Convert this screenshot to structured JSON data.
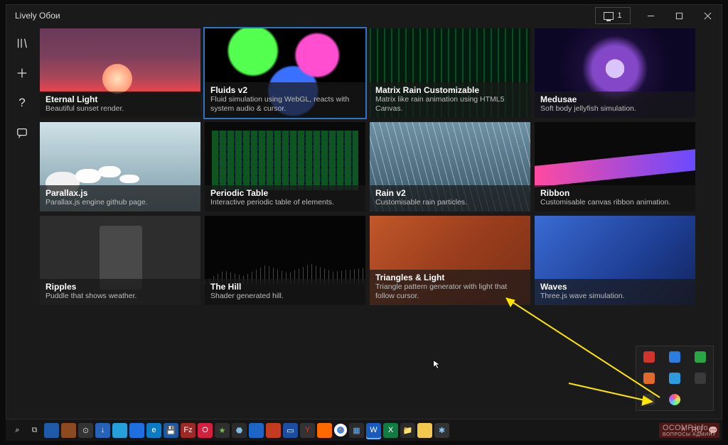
{
  "app": {
    "title": "Lively Обои"
  },
  "title_controls": {
    "screen_label": "1"
  },
  "nav": {
    "items": [
      {
        "name": "library-icon"
      },
      {
        "name": "add-icon"
      },
      {
        "name": "help-icon"
      },
      {
        "name": "feedback-icon"
      }
    ]
  },
  "gallery": [
    {
      "title": "Eternal Light",
      "desc": "Beautiful sunset render.",
      "thumb": "t-sunset",
      "selected": false
    },
    {
      "title": "Fluids v2",
      "desc": "Fluid simulation using WebGL, reacts with system audio & cursor.",
      "thumb": "t-fluids",
      "selected": true
    },
    {
      "title": "Matrix Rain Customizable",
      "desc": "Matrix like rain animation using HTML5 Canvas.",
      "thumb": "t-matrix",
      "selected": false
    },
    {
      "title": "Medusae",
      "desc": "Soft body jellyfish simulation.",
      "thumb": "t-medusa",
      "selected": false
    },
    {
      "title": "Parallax.js",
      "desc": "Parallax.js engine github page.",
      "thumb": "t-parallax",
      "selected": false
    },
    {
      "title": "Periodic Table",
      "desc": "Interactive periodic table of elements.",
      "thumb": "t-ptable",
      "selected": false
    },
    {
      "title": "Rain v2",
      "desc": "Customisable rain particles.",
      "thumb": "t-rain",
      "selected": false
    },
    {
      "title": "Ribbon",
      "desc": "Customisable canvas ribbon animation.",
      "thumb": "t-ribbon",
      "selected": false
    },
    {
      "title": "Ripples",
      "desc": "Puddle that shows weather.",
      "thumb": "t-ripples",
      "selected": false
    },
    {
      "title": "The Hill",
      "desc": "Shader generated hill.",
      "thumb": "t-hill",
      "selected": false
    },
    {
      "title": "Triangles & Light",
      "desc": "Triangle pattern generator with light that follow cursor.",
      "thumb": "t-triangles",
      "selected": false
    },
    {
      "title": "Waves",
      "desc": "Three.js wave simulation.",
      "thumb": "t-waves",
      "selected": false
    }
  ],
  "taskbar": {
    "left_icons": [
      {
        "name": "search-icon",
        "bg": "transparent",
        "glyph": "⌕",
        "color": "#fff"
      },
      {
        "name": "taskview-icon",
        "bg": "transparent",
        "glyph": "⧉",
        "color": "#ccc"
      },
      {
        "name": "app-1",
        "bg": "#1e5aa8",
        "glyph": "",
        "color": ""
      },
      {
        "name": "app-2",
        "bg": "#8b4a1f",
        "glyph": "",
        "color": ""
      },
      {
        "name": "app-3",
        "bg": "#333",
        "glyph": "⊙",
        "color": "#ccc"
      },
      {
        "name": "app-4",
        "bg": "#2762b9",
        "glyph": "↓",
        "color": "#fff"
      },
      {
        "name": "app-5",
        "bg": "#26a0da",
        "glyph": "",
        "color": ""
      },
      {
        "name": "app-6",
        "bg": "#1f6fe0",
        "glyph": "",
        "color": ""
      },
      {
        "name": "app-7",
        "bg": "#0a7bc4",
        "glyph": "e",
        "color": "#fff"
      },
      {
        "name": "app-8",
        "bg": "#1d58a0",
        "glyph": "💾",
        "color": ""
      },
      {
        "name": "app-9",
        "bg": "#9c2828",
        "glyph": "Fz",
        "color": "#fff"
      },
      {
        "name": "app-10",
        "bg": "#d3203f",
        "glyph": "O",
        "color": "#fff"
      },
      {
        "name": "app-11",
        "bg": "#2e2e2e",
        "glyph": "★",
        "color": "#7bbf4f"
      },
      {
        "name": "app-12",
        "bg": "#2b2b2b",
        "glyph": "⬣",
        "color": "#7fbce0"
      },
      {
        "name": "app-13",
        "bg": "#1d66c6",
        "glyph": "",
        "color": ""
      },
      {
        "name": "app-14",
        "bg": "#c23c1f",
        "glyph": "",
        "color": ""
      },
      {
        "name": "app-15",
        "bg": "#1b4ea0",
        "glyph": "▭",
        "color": "#fff"
      },
      {
        "name": "app-16",
        "bg": "#333",
        "glyph": "Y",
        "color": "#d33"
      },
      {
        "name": "app-17",
        "bg": "#ff6a00",
        "glyph": "",
        "color": ""
      },
      {
        "name": "app-18",
        "bg": "",
        "glyph": "",
        "color": "",
        "chrome": true
      },
      {
        "name": "app-19",
        "bg": "#2b2b2b",
        "glyph": "▦",
        "color": "#64b1ff"
      },
      {
        "name": "app-20",
        "bg": "#185abd",
        "glyph": "W",
        "color": "#fff",
        "active": true
      },
      {
        "name": "app-21",
        "bg": "#107c41",
        "glyph": "X",
        "color": "#fff"
      },
      {
        "name": "app-22",
        "bg": "#2b2b2b",
        "glyph": "📁",
        "color": ""
      },
      {
        "name": "app-23",
        "bg": "#f2c94c",
        "glyph": "",
        "color": ""
      },
      {
        "name": "app-24",
        "bg": "#333",
        "glyph": "✱",
        "color": "#7ecbff"
      }
    ],
    "right": {
      "lang": "RU"
    }
  },
  "tray": {
    "icons": [
      {
        "name": "tray-1",
        "bg": "#d0342c"
      },
      {
        "name": "tray-2",
        "bg": "#2c7de0"
      },
      {
        "name": "tray-3",
        "bg": "#29a745"
      },
      {
        "name": "tray-4",
        "bg": "#e06a2c"
      },
      {
        "name": "tray-5",
        "bg": "#2c9be0"
      },
      {
        "name": "tray-6",
        "bg": "#3a3a3a"
      },
      {
        "name": "tray-7",
        "bg": "#333"
      },
      {
        "name": "tray-8",
        "bg": "#333",
        "lively": true
      },
      {
        "name": "tray-9",
        "bg": "transparent"
      }
    ]
  },
  "watermark": {
    "brand": "OCOMP.info",
    "sub": "ВОПРОСЫ АДМИНУ"
  }
}
